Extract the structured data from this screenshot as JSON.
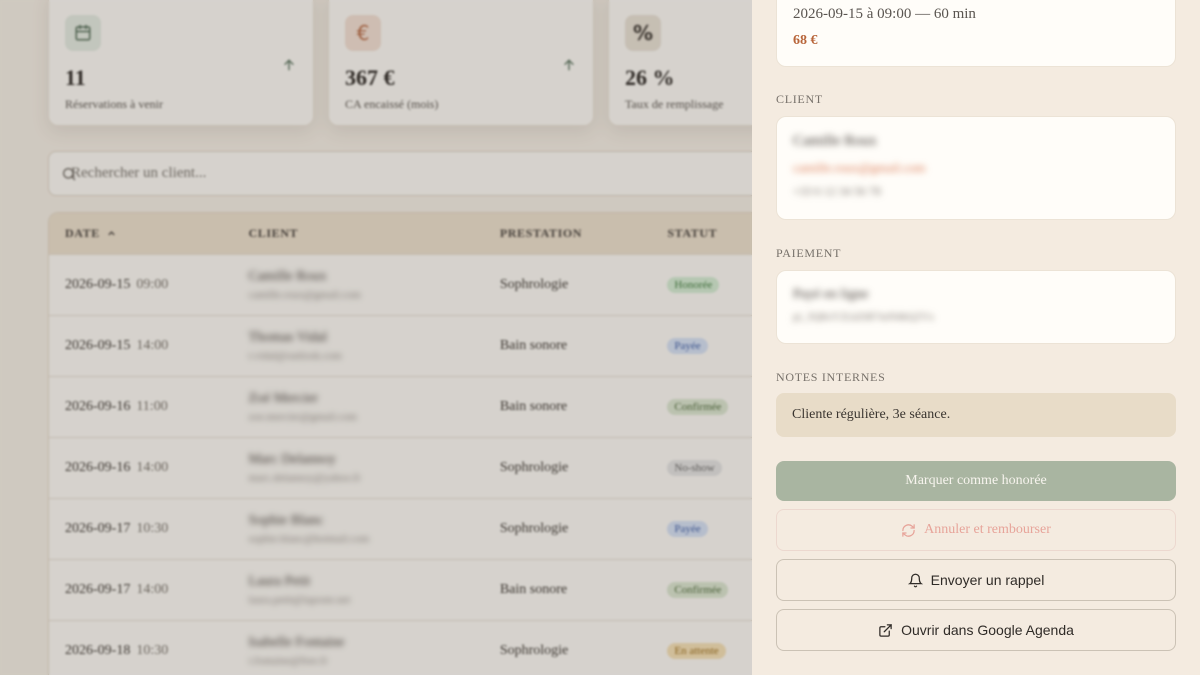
{
  "stats": [
    {
      "value": "11",
      "label": "Réservations à venir",
      "icon": "calendar-icon"
    },
    {
      "value": "367 €",
      "label": "CA encaissé (mois)",
      "icon": "euro-icon",
      "symbol": "€"
    },
    {
      "value": "26 %",
      "label": "Taux de remplissage",
      "icon": "percent-icon",
      "symbol": "%"
    }
  ],
  "search": {
    "placeholder": "Rechercher un client..."
  },
  "table": {
    "headers": {
      "date": "DATE",
      "client": "CLIENT",
      "prestation": "PRESTATION",
      "statut": "STATUT"
    },
    "rows": [
      {
        "date": "2026-09-15",
        "time": "09:00",
        "client_name": "Camille Roux",
        "client_email": "camille.roux@gmail.com",
        "prestation": "Sophrologie",
        "statut": "Honorée"
      },
      {
        "date": "2026-09-15",
        "time": "14:00",
        "client_name": "Thomas Vidal",
        "client_email": "t.vidal@outlook.com",
        "prestation": "Bain sonore",
        "statut": "Payée"
      },
      {
        "date": "2026-09-16",
        "time": "11:00",
        "client_name": "Zoé Mercier",
        "client_email": "zoe.mercier@gmail.com",
        "prestation": "Bain sonore",
        "statut": "Confirmée"
      },
      {
        "date": "2026-09-16",
        "time": "14:00",
        "client_name": "Marc Delannoy",
        "client_email": "marc.delannoy@yahoo.fr",
        "prestation": "Sophrologie",
        "statut": "No-show"
      },
      {
        "date": "2026-09-17",
        "time": "10:30",
        "client_name": "Sophie Blanc",
        "client_email": "sophie.blanc@hotmail.com",
        "prestation": "Sophrologie",
        "statut": "Payée"
      },
      {
        "date": "2026-09-17",
        "time": "14:00",
        "client_name": "Laura Petit",
        "client_email": "laura.petit@laposte.net",
        "prestation": "Bain sonore",
        "statut": "Confirmée"
      },
      {
        "date": "2026-09-18",
        "time": "10:30",
        "client_name": "Isabelle Fontaine",
        "client_email": "i.fontaine@free.fr",
        "prestation": "Sophrologie",
        "statut": "En attente"
      }
    ]
  },
  "panel": {
    "appointment": {
      "when": "2026-09-15 à 09:00 — 60 min",
      "price": "68 €"
    },
    "client_label": "CLIENT",
    "client": {
      "name": "Camille Roux",
      "email": "camille.roux@gmail.com",
      "phone": "+33 6 12 34 56 78"
    },
    "payment_label": "PAIEMENT",
    "payment": {
      "ref": "Payé en ligne",
      "id": "pi_3Q8xY2LkZtR7mN4bQ2Vx"
    },
    "notes_label": "NOTES INTERNES",
    "notes": "Cliente régulière, 3e séance.",
    "buttons": {
      "mark_honored": "Marquer comme honorée",
      "cancel_refund": "Annuler et rembourser",
      "send_reminder": "Envoyer un rappel",
      "open_gcal": "Ouvrir dans Google Agenda"
    }
  },
  "colors": {
    "accent_sage": "#a9b5a1",
    "price": "#b8653a",
    "cancel": "#e7a49a",
    "panel_bg": "#f4ebe0"
  }
}
